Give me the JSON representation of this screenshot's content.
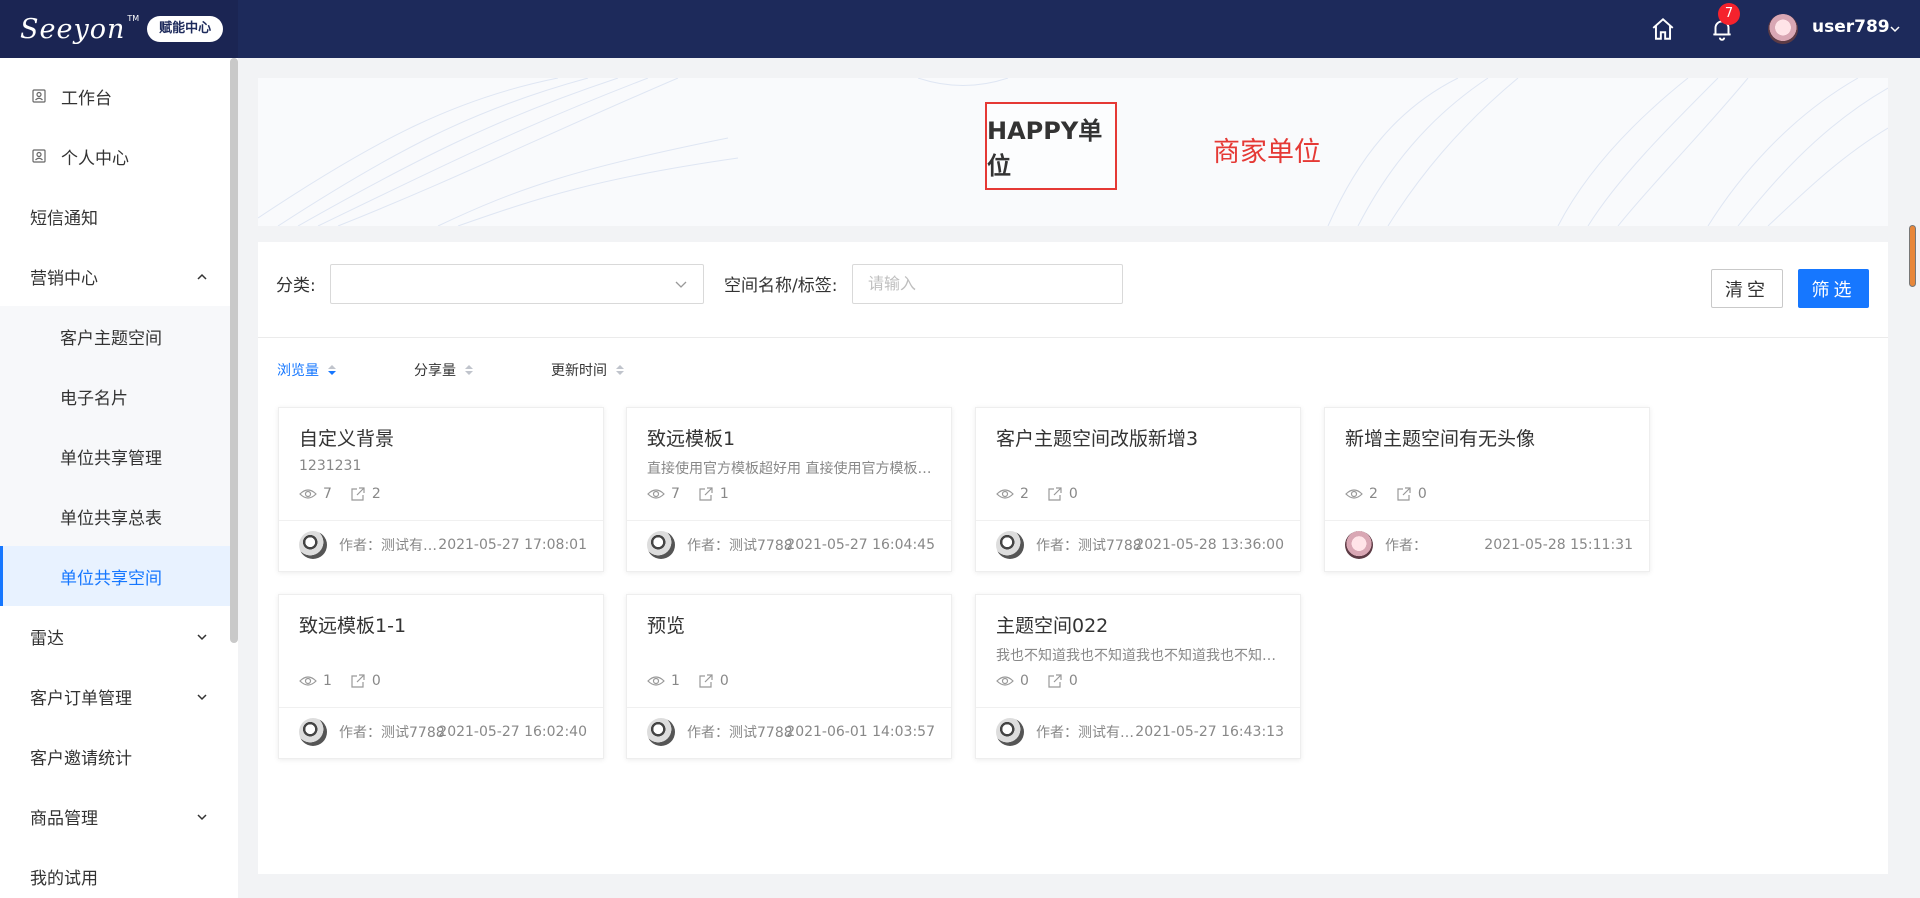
{
  "header": {
    "logo_text": "Seeyon",
    "logo_tm": "TM",
    "badge": "赋能中心",
    "notification_count": "7",
    "username": "user789"
  },
  "sidebar": {
    "items": [
      {
        "label": "工作台"
      },
      {
        "label": "个人中心"
      },
      {
        "label": "短信通知"
      },
      {
        "label": "营销中心"
      },
      {
        "label": "客户主题空间"
      },
      {
        "label": "电子名片"
      },
      {
        "label": "单位共享管理"
      },
      {
        "label": "单位共享总表"
      },
      {
        "label": "单位共享空间"
      },
      {
        "label": "雷达"
      },
      {
        "label": "客户订单管理"
      },
      {
        "label": "客户邀请统计"
      },
      {
        "label": "商品管理"
      },
      {
        "label": "我的试用"
      }
    ]
  },
  "banner": {
    "logo_text": "HAPPY单位",
    "title": "商家单位"
  },
  "filters": {
    "category_label": "分类:",
    "category_value": "",
    "name_label": "空间名称/标签:",
    "name_placeholder": "请输入",
    "clear_label": "清空",
    "filter_label": "筛选"
  },
  "sort": {
    "options": [
      {
        "label": "浏览量"
      },
      {
        "label": "分享量"
      },
      {
        "label": "更新时间"
      }
    ],
    "active": "浏览量"
  },
  "cards": [
    {
      "title": "自定义背景",
      "desc": "1231231",
      "views": "7",
      "shares": "2",
      "author": "作者：测试有限公司",
      "date": "2021-05-27 17:08:01"
    },
    {
      "title": "致远模板1",
      "desc": "直接使用官方模板超好用 直接使用官方模板超好用",
      "views": "7",
      "shares": "1",
      "author": "作者：测试7788",
      "date": "2021-05-27 16:04:45"
    },
    {
      "title": "客户主题空间改版新增3",
      "desc": "",
      "views": "2",
      "shares": "0",
      "author": "作者：测试7788",
      "date": "2021-05-28 13:36:00"
    },
    {
      "title": "新增主题空间有无头像",
      "desc": "",
      "views": "2",
      "shares": "0",
      "author": "作者：",
      "date": "2021-05-28 15:11:31"
    },
    {
      "title": "致远模板1-1",
      "desc": "",
      "views": "1",
      "shares": "0",
      "author": "作者：测试7788",
      "date": "2021-05-27 16:02:40"
    },
    {
      "title": "预览",
      "desc": "",
      "views": "1",
      "shares": "0",
      "author": "作者：测试7788",
      "date": "2021-06-01 14:03:57"
    },
    {
      "title": "主题空间022",
      "desc": "我也不知道我也不知道我也不知道我也不知道我也不知道",
      "views": "0",
      "shares": "0",
      "author": "作者：测试有限公司",
      "date": "2021-05-27 16:43:13"
    }
  ],
  "colors": {
    "header_bg": "#1d2a5b",
    "accent": "#1677ff",
    "badge_red": "#f5222d",
    "banner_red": "#e53935"
  }
}
